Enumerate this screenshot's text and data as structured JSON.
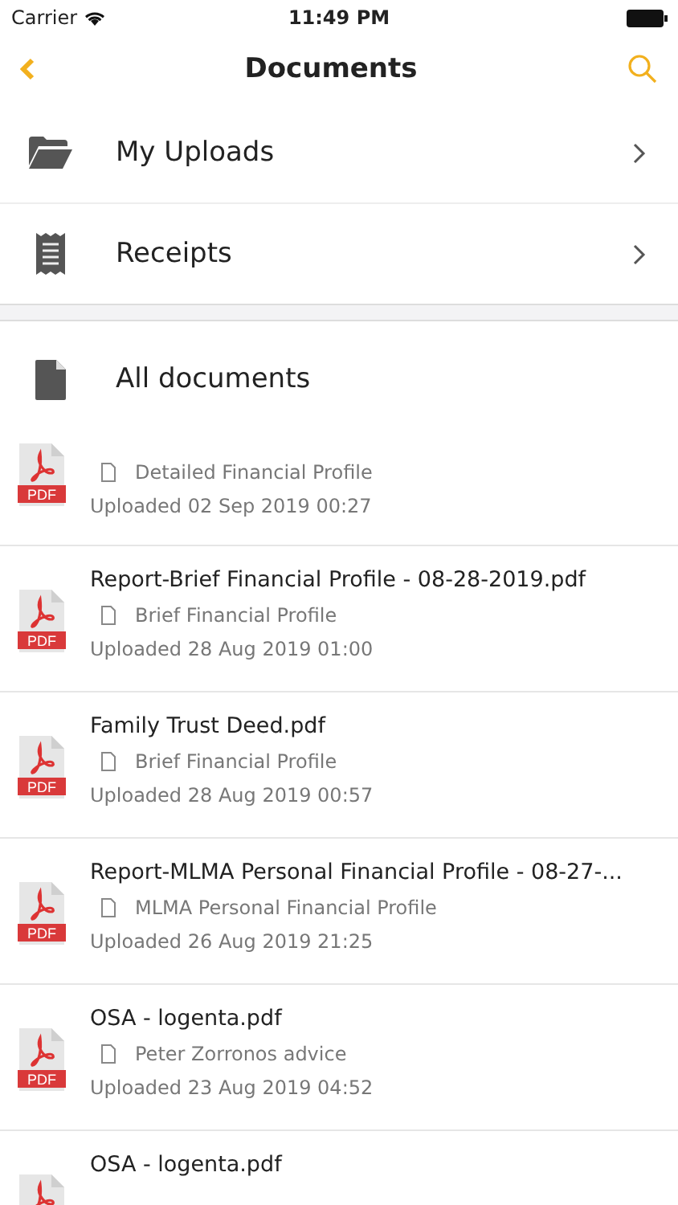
{
  "status_bar": {
    "carrier": "Carrier",
    "time": "11:49 PM"
  },
  "nav": {
    "title": "Documents"
  },
  "folders": [
    {
      "kind": "folder",
      "label": "My Uploads"
    },
    {
      "kind": "receipt",
      "label": "Receipts"
    }
  ],
  "all_documents": {
    "label": "All documents"
  },
  "documents": [
    {
      "file_type": "PDF",
      "category": "Detailed Financial Profile",
      "uploaded": "Uploaded 02 Sep 2019 00:27"
    },
    {
      "file_type": "PDF",
      "title": "Report-Brief Financial Profile - 08-28-2019.pdf",
      "category": "Brief Financial Profile",
      "uploaded": "Uploaded 28 Aug 2019 01:00"
    },
    {
      "file_type": "PDF",
      "title": "Family Trust Deed.pdf",
      "category": "Brief Financial Profile",
      "uploaded": "Uploaded 28 Aug 2019 00:57"
    },
    {
      "file_type": "PDF",
      "title": "Report-MLMA Personal Financial Profile - 08-27-...",
      "category": "MLMA Personal Financial Profile",
      "uploaded": "Uploaded 26 Aug 2019 21:25"
    },
    {
      "file_type": "PDF",
      "title": "OSA - logenta.pdf",
      "category": "Peter Zorronos advice",
      "uploaded": "Uploaded 23 Aug 2019 04:52"
    },
    {
      "title": "OSA - logenta.pdf"
    }
  ]
}
